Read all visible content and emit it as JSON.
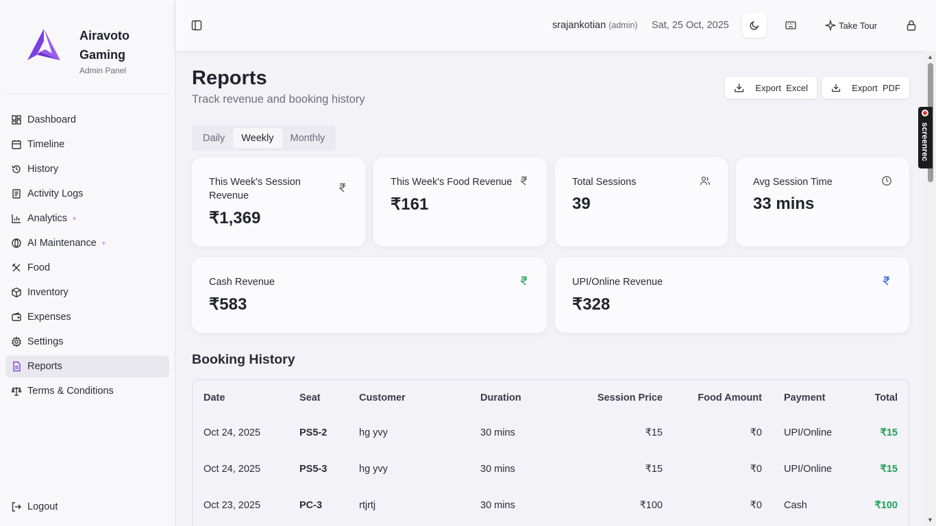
{
  "brand": {
    "name_line1": "Airavoto",
    "name_line2": "Gaming",
    "subtitle": "Admin Panel",
    "logo_color": "#7b3fe4"
  },
  "sidebar": {
    "items": [
      {
        "label": "Dashboard",
        "icon": "dashboard-icon"
      },
      {
        "label": "Timeline",
        "icon": "calendar-icon"
      },
      {
        "label": "History",
        "icon": "history-icon"
      },
      {
        "label": "Activity Logs",
        "icon": "logs-icon"
      },
      {
        "label": "Analytics",
        "icon": "chart-icon",
        "sparkle": true
      },
      {
        "label": "AI Maintenance",
        "icon": "globe-icon",
        "sparkle": true
      },
      {
        "label": "Food",
        "icon": "utensils-icon"
      },
      {
        "label": "Inventory",
        "icon": "package-icon"
      },
      {
        "label": "Expenses",
        "icon": "wallet-icon"
      },
      {
        "label": "Settings",
        "icon": "gear-icon"
      },
      {
        "label": "Reports",
        "icon": "document-icon",
        "active": true
      },
      {
        "label": "Terms & Conditions",
        "icon": "scale-icon"
      }
    ],
    "logout_label": "Logout"
  },
  "topbar": {
    "username": "srajankotian",
    "role": "(admin)",
    "date": "Sat, 25 Oct, 2025",
    "tour_label": "Take Tour"
  },
  "page": {
    "title": "Reports",
    "subtitle": "Track revenue and booking history",
    "export_excel_label": "Export  Excel",
    "export_pdf_label": "Export  PDF"
  },
  "tabs": [
    "Daily",
    "Weekly",
    "Monthly"
  ],
  "active_tab": "Weekly",
  "stats": {
    "session_revenue": {
      "label": "This Week's Session Revenue",
      "value": "₹1,369"
    },
    "food_revenue": {
      "label": "This Week's Food Revenue",
      "value": "₹161"
    },
    "total_sessions": {
      "label": "Total Sessions",
      "value": "39"
    },
    "avg_session": {
      "label": "Avg Session Time",
      "value": "33 mins"
    },
    "cash_revenue": {
      "label": "Cash Revenue",
      "value": "₹583",
      "icon_color": "#1fa056"
    },
    "upi_revenue": {
      "label": "UPI/Online Revenue",
      "value": "₹328",
      "icon_color": "#2f5fd8"
    }
  },
  "booking_history": {
    "title": "Booking History",
    "columns": [
      "Date",
      "Seat",
      "Customer",
      "Duration",
      "Session Price",
      "Food Amount",
      "Payment",
      "Total"
    ],
    "rows": [
      [
        "Oct 24, 2025",
        "PS5-2",
        "hg yvy",
        "30 mins",
        "₹15",
        "₹0",
        "UPI/Online",
        "₹15"
      ],
      [
        "Oct 24, 2025",
        "PS5-3",
        "hg yvy",
        "30 mins",
        "₹15",
        "₹0",
        "UPI/Online",
        "₹15"
      ],
      [
        "Oct 23, 2025",
        "PC-3",
        "rtjrtj",
        "30 mins",
        "₹100",
        "₹0",
        "Cash",
        "₹100"
      ]
    ]
  },
  "recorder": {
    "label": "screenrec"
  },
  "colors": {
    "accent": "#7b3fe4",
    "total_green": "#1fa056"
  }
}
